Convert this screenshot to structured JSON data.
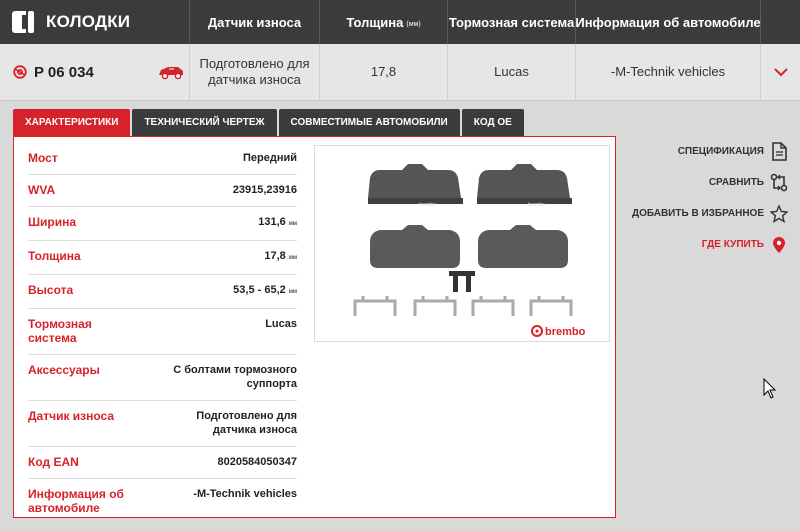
{
  "header": {
    "title": "КОЛОДКИ",
    "columns": {
      "wear_sensor": "Датчик износа",
      "thickness": "Толщина",
      "thickness_unit": "(мм)",
      "brake_system": "Тормозная система",
      "vehicle_info": "Информация об автомобиле"
    }
  },
  "product": {
    "code": "P 06 034",
    "wear_sensor": "Подготовлено для датчика износа",
    "thickness": "17,8",
    "brake_system": "Lucas",
    "vehicle_info": "-M-Technik vehicles"
  },
  "tabs": [
    {
      "label": "ХАРАКТЕРИСТИКИ",
      "active": true
    },
    {
      "label": "ТЕХНИЧЕСКИЙ ЧЕРТЕЖ",
      "active": false
    },
    {
      "label": "СОВМЕСТИМЫЕ АВТОМОБИЛИ",
      "active": false
    },
    {
      "label": "КОД ОЕ",
      "active": false
    }
  ],
  "specs": {
    "axle": {
      "label": "Мост",
      "value": "Передний"
    },
    "wva": {
      "label": "WVA",
      "value": "23915,23916"
    },
    "width": {
      "label": "Ширина",
      "value": "131,6",
      "unit": "мм"
    },
    "thickness": {
      "label": "Толщина",
      "value": "17,8",
      "unit": "мм"
    },
    "height": {
      "label": "Высота",
      "value": "53,5 - 65,2",
      "unit": "мм"
    },
    "brake_system": {
      "label": "Тормозная система",
      "value": "Lucas"
    },
    "accessories": {
      "label": "Аксессуары",
      "value": "С болтами тормозного суппорта"
    },
    "wear_sensor": {
      "label": "Датчик износа",
      "value": "Подготовлено для датчика износа"
    },
    "ean": {
      "label": "Код EAN",
      "value": "8020584050347"
    },
    "vehicle_info": {
      "label": "Информация об автомобиле",
      "value": "-M-Technik vehicles"
    }
  },
  "image": {
    "brand_logo": "brembo",
    "pad_print": "brembo"
  },
  "actions": {
    "spec": "СПЕЦИФИКАЦИЯ",
    "compare": "СРАВНИТЬ",
    "favorite": "ДОБАВИТЬ В ИЗБРАННОЕ",
    "where_buy": "ГДЕ КУПИТЬ"
  },
  "colors": {
    "accent": "#d6222b",
    "header_bg": "#3b3b3b",
    "page_bg": "#d9d9d9"
  },
  "icons": {
    "header": "brake-pad-icon",
    "product": "brake-disc-icon",
    "car": "car-icon",
    "expand": "chevron-down-icon",
    "spec": "document-icon",
    "compare": "compare-icon",
    "favorite": "star-icon",
    "where_buy": "location-pin-icon"
  }
}
